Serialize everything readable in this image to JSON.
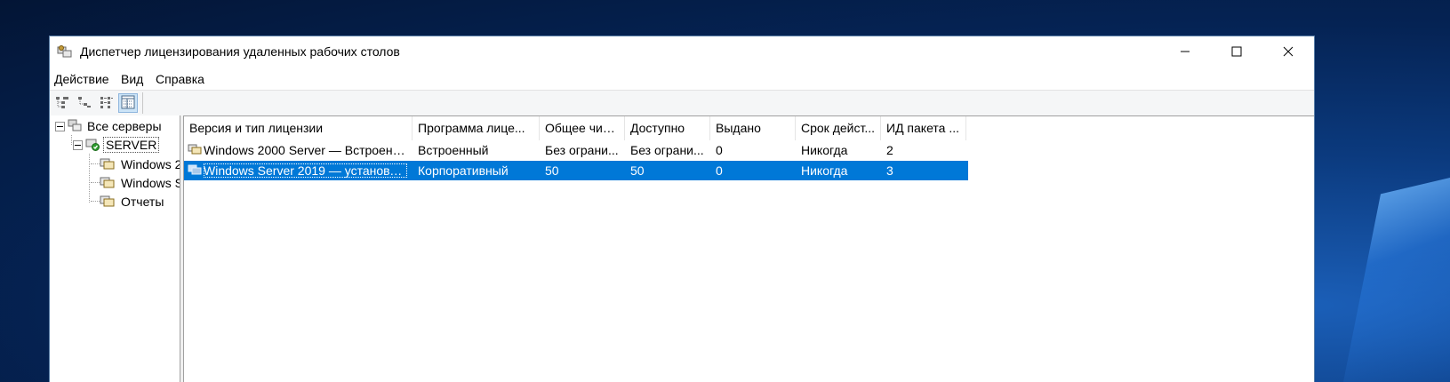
{
  "window": {
    "title": "Диспетчер лицензирования удаленных рабочих столов",
    "controls": {
      "minimize": "minimize",
      "maximize": "maximize",
      "close": "close"
    }
  },
  "menu": [
    "Действие",
    "Вид",
    "Справка"
  ],
  "toolbar": {
    "buttons": [
      {
        "icon": "tree-view-icon",
        "active": false
      },
      {
        "icon": "tree-collapsed-view-icon",
        "active": false
      },
      {
        "icon": "list-view-icon",
        "active": false
      },
      {
        "icon": "details-view-icon",
        "active": true
      }
    ]
  },
  "tree": {
    "root": "Все серверы",
    "server": "SERVER",
    "children": [
      "Windows 2",
      "Windows S",
      "Отчеты"
    ]
  },
  "table": {
    "columns": [
      "Версия и тип лицензии",
      "Программа лице...",
      "Общее чис...",
      "Доступно",
      "Выдано",
      "Срок дейст...",
      "ИД пакета ..."
    ],
    "rows": [
      {
        "cells": [
          "Windows 2000 Server — Встроенн...",
          "Встроенный",
          "Без ограни...",
          "Без ограни...",
          "0",
          "Никогда",
          "2"
        ],
        "selected": false
      },
      {
        "cells": [
          "Windows Server 2019 — установле...",
          "Корпоративный",
          "50",
          "50",
          "0",
          "Никогда",
          "3"
        ],
        "selected": true
      }
    ]
  },
  "colors": {
    "selection": "#0078d7",
    "desktop": "#052354"
  }
}
